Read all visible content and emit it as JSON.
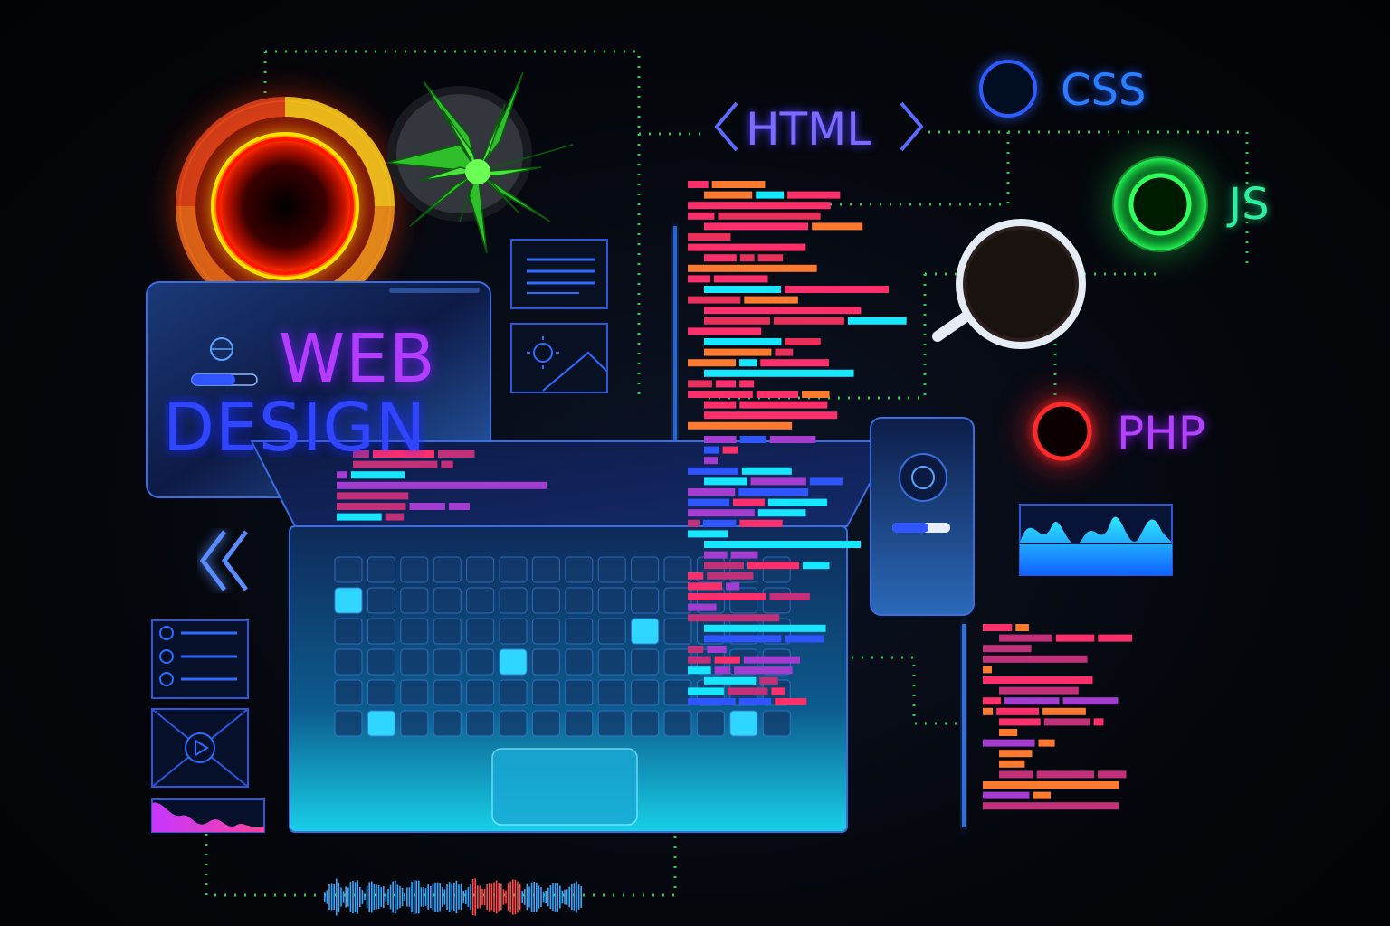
{
  "scene": {
    "headline_line1": "WEB",
    "headline_line2": "DESIGN",
    "tech_labels": {
      "html": "HTML",
      "css": "CSS",
      "js": "JS",
      "php": "PHP"
    }
  },
  "icons": [
    "red-ring-icon",
    "succulent-plant-icon",
    "text-card-icon",
    "image-card-icon",
    "magnifier-icon",
    "blue-ring-icon",
    "green-ring-icon",
    "red-small-ring-icon",
    "double-chevron-left-icon",
    "checklist-card-icon",
    "video-play-card-icon",
    "waveform-chart-icon",
    "globe-icon",
    "audio-wave-icon"
  ],
  "colors": {
    "background": "#05070d",
    "neon_red": "#ff2a2a",
    "neon_green": "#22ff55",
    "neon_blue": "#2d7dff",
    "neon_purple": "#b441ff",
    "neon_cyan": "#17e6ff",
    "code_pink": "#ff2f6b",
    "code_orange": "#ff7a2f",
    "dots_green": "#35ff6a"
  }
}
